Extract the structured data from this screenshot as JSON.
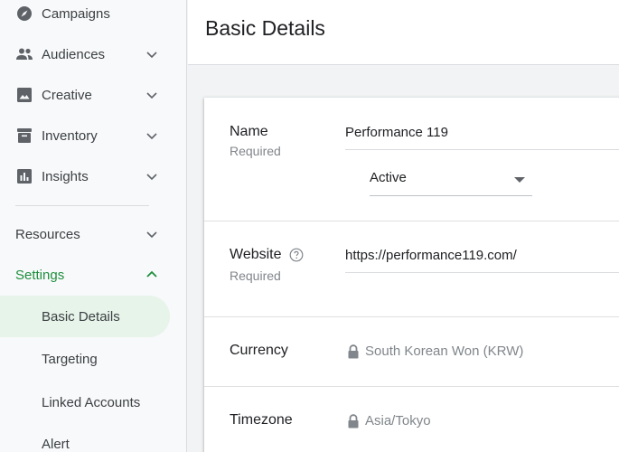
{
  "sidebar": {
    "items": [
      {
        "label": "Campaigns",
        "icon": "compass-icon",
        "expandable": false
      },
      {
        "label": "Audiences",
        "icon": "people-icon",
        "expandable": true
      },
      {
        "label": "Creative",
        "icon": "image-icon",
        "expandable": true
      },
      {
        "label": "Inventory",
        "icon": "archive-icon",
        "expandable": true
      },
      {
        "label": "Insights",
        "icon": "bar-chart-icon",
        "expandable": true
      }
    ],
    "resources_label": "Resources",
    "settings_label": "Settings",
    "settings_items": [
      {
        "label": "Basic Details",
        "active": true
      },
      {
        "label": "Targeting",
        "active": false
      },
      {
        "label": "Linked Accounts",
        "active": false
      },
      {
        "label": "Alert",
        "active": false
      }
    ]
  },
  "header": {
    "title": "Basic Details"
  },
  "form": {
    "name": {
      "label": "Name",
      "sublabel": "Required",
      "value": "Performance 119"
    },
    "status": {
      "value": "Active"
    },
    "website": {
      "label": "Website",
      "sublabel": "Required",
      "value": "https://performance119.com/"
    },
    "currency": {
      "label": "Currency",
      "value": "South Korean Won (KRW)"
    },
    "timezone": {
      "label": "Timezone",
      "value": "Asia/Tokyo"
    }
  },
  "colors": {
    "accent": "#1e8e3e",
    "active_bg": "#e6f4ea",
    "icon": "#5f6368"
  }
}
